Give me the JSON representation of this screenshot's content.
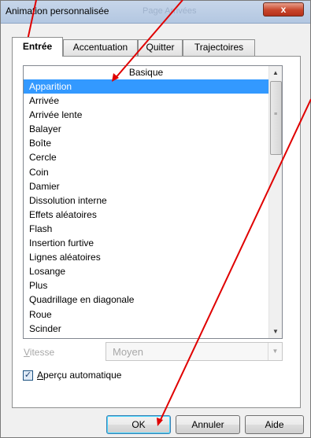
{
  "window": {
    "title": "Animation personnalisée",
    "ghost_title": "Page         Arrivées",
    "close_symbol": "x"
  },
  "tabs": [
    {
      "label": "Entrée",
      "active": true
    },
    {
      "label": "Accentuation",
      "active": false
    },
    {
      "label": "Quitter",
      "active": false
    },
    {
      "label": "Trajectoires",
      "active": false
    }
  ],
  "list": {
    "header": "Basique",
    "selected_index": 0,
    "items": [
      "Apparition",
      "Arrivée",
      "Arrivée lente",
      "Balayer",
      "Boîte",
      "Cercle",
      "Coin",
      "Damier",
      "Dissolution interne",
      "Effets aléatoires",
      "Flash",
      "Insertion furtive",
      "Lignes aléatoires",
      "Losange",
      "Plus",
      "Quadrillage en diagonale",
      "Roue",
      "Scinder"
    ]
  },
  "speed": {
    "label": "Vitesse",
    "value": "Moyen"
  },
  "preview": {
    "label": "Aperçu automatique",
    "checked": true
  },
  "buttons": {
    "ok": "OK",
    "cancel": "Annuler",
    "help": "Aide"
  },
  "colors": {
    "selection": "#3399ff",
    "annotation_arrows": "#e00000"
  },
  "icons": {
    "scroll_up": "scroll-up-icon",
    "scroll_down": "scroll-down-icon",
    "dropdown": "chevron-down-icon",
    "check": "checkmark-icon"
  }
}
